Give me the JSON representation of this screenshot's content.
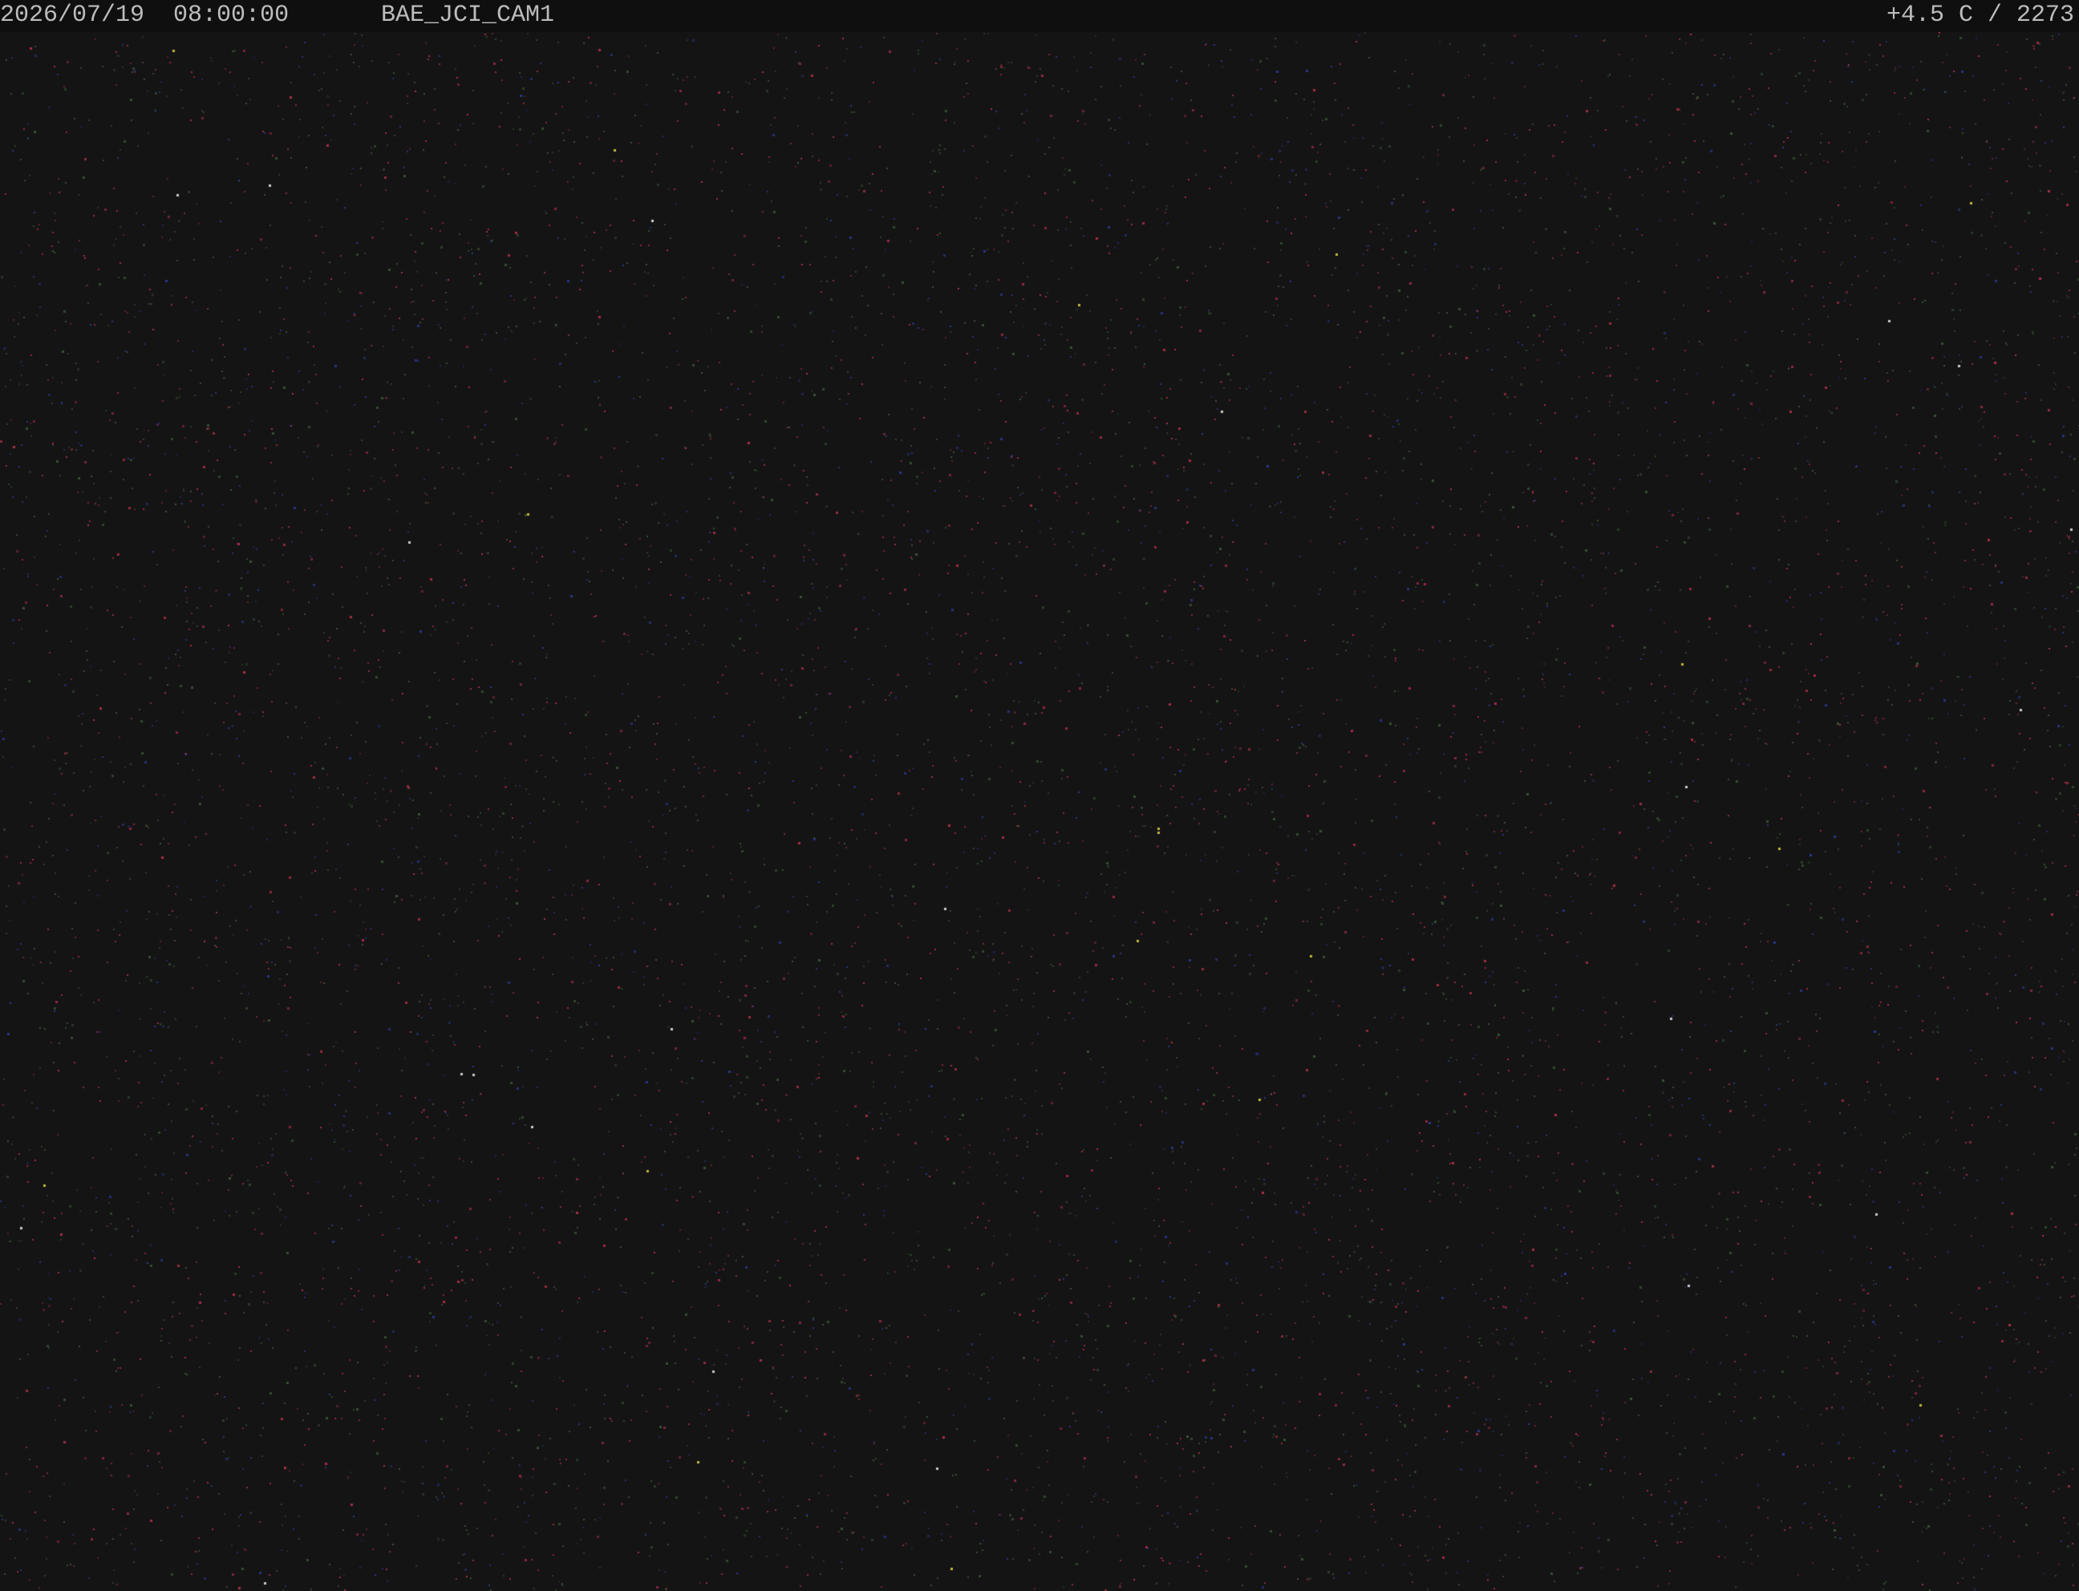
{
  "overlay": {
    "date": "2026/07/19",
    "time": "08:00:00",
    "camera_id": "BAE_JCI_CAM1",
    "temperature": "+4.5 C",
    "counter": "2273"
  },
  "scene": {
    "description_colors": {
      "background": "#141414",
      "overlay_bar": "#0f0f0f",
      "overlay_text": "#bdbdbd",
      "noise_red": "#b8324e",
      "noise_green": "#3d5a3a",
      "noise_blue": "#2e3b9a"
    }
  }
}
